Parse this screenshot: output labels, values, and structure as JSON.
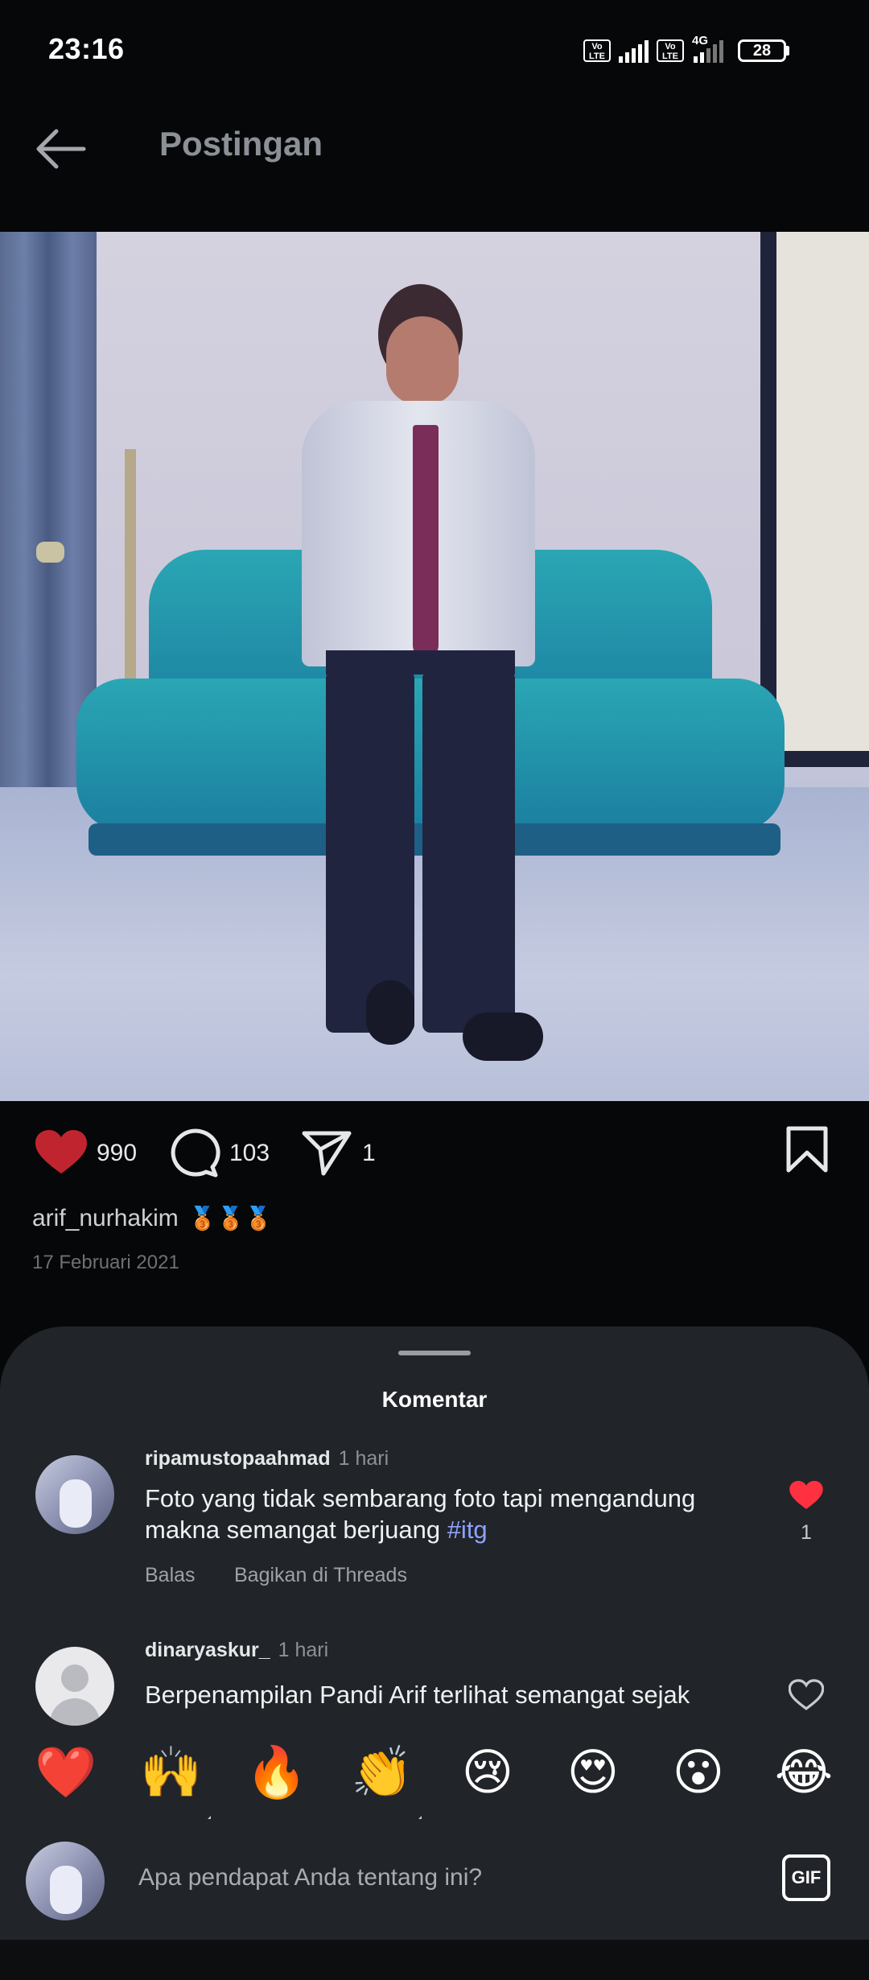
{
  "status_bar": {
    "time": "23:16",
    "volte1": "Vo LTE",
    "volte2": "Vo LTE",
    "network": "4G",
    "battery": "28"
  },
  "header": {
    "title": "Postingan",
    "back_icon": "arrow-left-icon"
  },
  "post": {
    "likes": "990",
    "comments": "103",
    "shares": "1",
    "username": "arif_nurhakim",
    "badges": "🥉🥉🥉",
    "date": "17 Februari 2021",
    "accent_like": "#c0252f"
  },
  "sheet": {
    "title": "Komentar",
    "comments": [
      {
        "user": "ripamustopaahmad",
        "time": "1 hari",
        "text": "Foto yang tidak sembarang foto tapi mengandung makna semangat berjuang ",
        "hashtag": "#itg",
        "reply": "Balas",
        "share": "Bagikan di Threads",
        "likes": "1",
        "liked": true
      },
      {
        "user": "dinaryaskur_",
        "time": "1 hari",
        "text": "Berpenampilan Pandi Arif terlihat semangat sejak",
        "liked": false
      }
    ]
  },
  "emoji_bar": [
    "❤️",
    "🙌",
    "🔥",
    "👏",
    "😢",
    "😍",
    "😮",
    "😂"
  ],
  "composer": {
    "placeholder": "Apa pendapat Anda tentang ini?",
    "gif_label": "GIF"
  }
}
